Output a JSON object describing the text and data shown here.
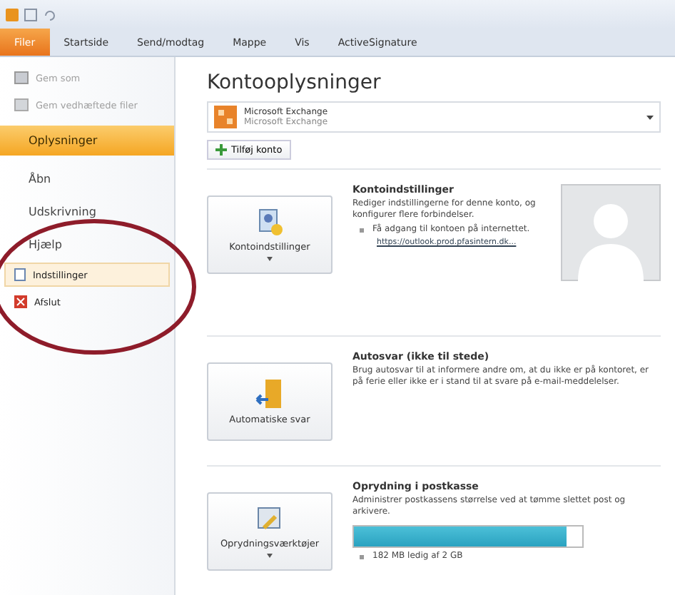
{
  "ribbon_tabs": [
    {
      "label": "Filer",
      "selected": true
    },
    {
      "label": "Startside",
      "selected": false
    },
    {
      "label": "Send/modtag",
      "selected": false
    },
    {
      "label": "Mappe",
      "selected": false
    },
    {
      "label": "Vis",
      "selected": false
    },
    {
      "label": "ActiveSignature",
      "selected": false
    }
  ],
  "sidebar": {
    "items": [
      {
        "kind": "command",
        "label": "Gem som",
        "disabled": true,
        "selected": false
      },
      {
        "kind": "command",
        "label": "Gem vedhæftede filer",
        "disabled": true,
        "selected": false
      },
      {
        "kind": "tab",
        "label": "Oplysninger",
        "selected": true
      },
      {
        "kind": "tab",
        "label": "Åbn",
        "selected": false
      },
      {
        "kind": "tab",
        "label": "Udskrivning",
        "selected": false
      },
      {
        "kind": "tab",
        "label": "Hjælp",
        "selected": false
      },
      {
        "kind": "command",
        "label": "Indstillinger",
        "disabled": false,
        "selected": true
      },
      {
        "kind": "command",
        "label": "Afslut",
        "disabled": false,
        "selected": false
      }
    ]
  },
  "content": {
    "title": "Kontooplysninger",
    "account": {
      "name": "Microsoft Exchange",
      "type": "Microsoft Exchange"
    },
    "add_account": "Tilføj konto",
    "sections": [
      {
        "button": "Kontoindstillinger",
        "dropdown": true,
        "title": "Kontoindstillinger",
        "description": "Rediger indstillingerne for denne konto, og konfigurer flere forbindelser.",
        "bullet": "Få adgang til kontoen på internettet.",
        "link": "https://outlook.prod.pfasintern.dk..."
      },
      {
        "button": "Automatiske svar",
        "dropdown": false,
        "title": "Autosvar (ikke til stede)",
        "description": "Brug autosvar til at informere andre om, at du ikke er på kontoret, er på ferie eller ikke er i stand til at svare på e-mail-meddelelser."
      },
      {
        "button": "Oprydningsværktøjer",
        "dropdown": true,
        "title": "Oprydning i postkasse",
        "description": "Administrer postkassens størrelse ved at tømme slettet post og arkivere.",
        "level": 0.93,
        "reading": "182 MB ledig af 2 GB"
      }
    ]
  }
}
